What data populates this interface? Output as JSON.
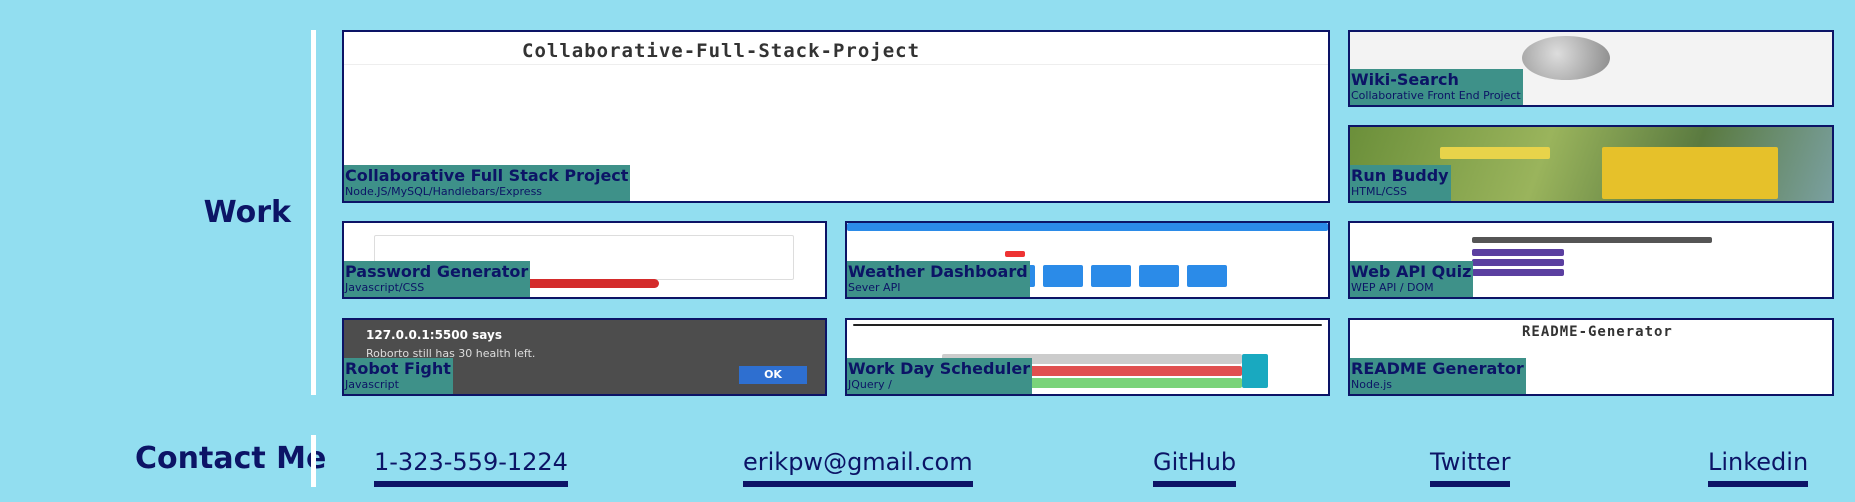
{
  "work": {
    "title": "Work",
    "projects": [
      {
        "name": "Collaborative Full Stack Project",
        "tech": "Node.JS/MySQL/Handlebars/Express",
        "screenshot_heading": "Collaborative-Full-Stack-Project"
      },
      {
        "name": "Wiki-Search",
        "tech": "Collaborative Front End Project"
      },
      {
        "name": "Run Buddy",
        "tech": "HTML/CSS"
      },
      {
        "name": "Password Generator",
        "tech": "Javascript/CSS"
      },
      {
        "name": "Weather Dashboard",
        "tech": "Sever API"
      },
      {
        "name": "Web API Quiz",
        "tech": "WEP API / DOM"
      },
      {
        "name": "Robot Fight",
        "tech": "Javascript",
        "dialog_title": "127.0.0.1:5500 says",
        "dialog_message": "Roborto still has 30 health left.",
        "dialog_button": "OK"
      },
      {
        "name": "Work Day Scheduler",
        "tech": "JQuery /"
      },
      {
        "name": "README Generator",
        "tech": "Node.js",
        "screenshot_heading": "README-Generator"
      }
    ]
  },
  "contact": {
    "title": "Contact Me",
    "links": [
      {
        "label": "1-323-559-1224"
      },
      {
        "label": "erikpw@gmail.com"
      },
      {
        "label": "GitHub"
      },
      {
        "label": "Twitter"
      },
      {
        "label": "Linkedin"
      }
    ]
  },
  "colors": {
    "background": "#92def0",
    "text": "#0c1466",
    "label_bg": "#3e9189"
  }
}
